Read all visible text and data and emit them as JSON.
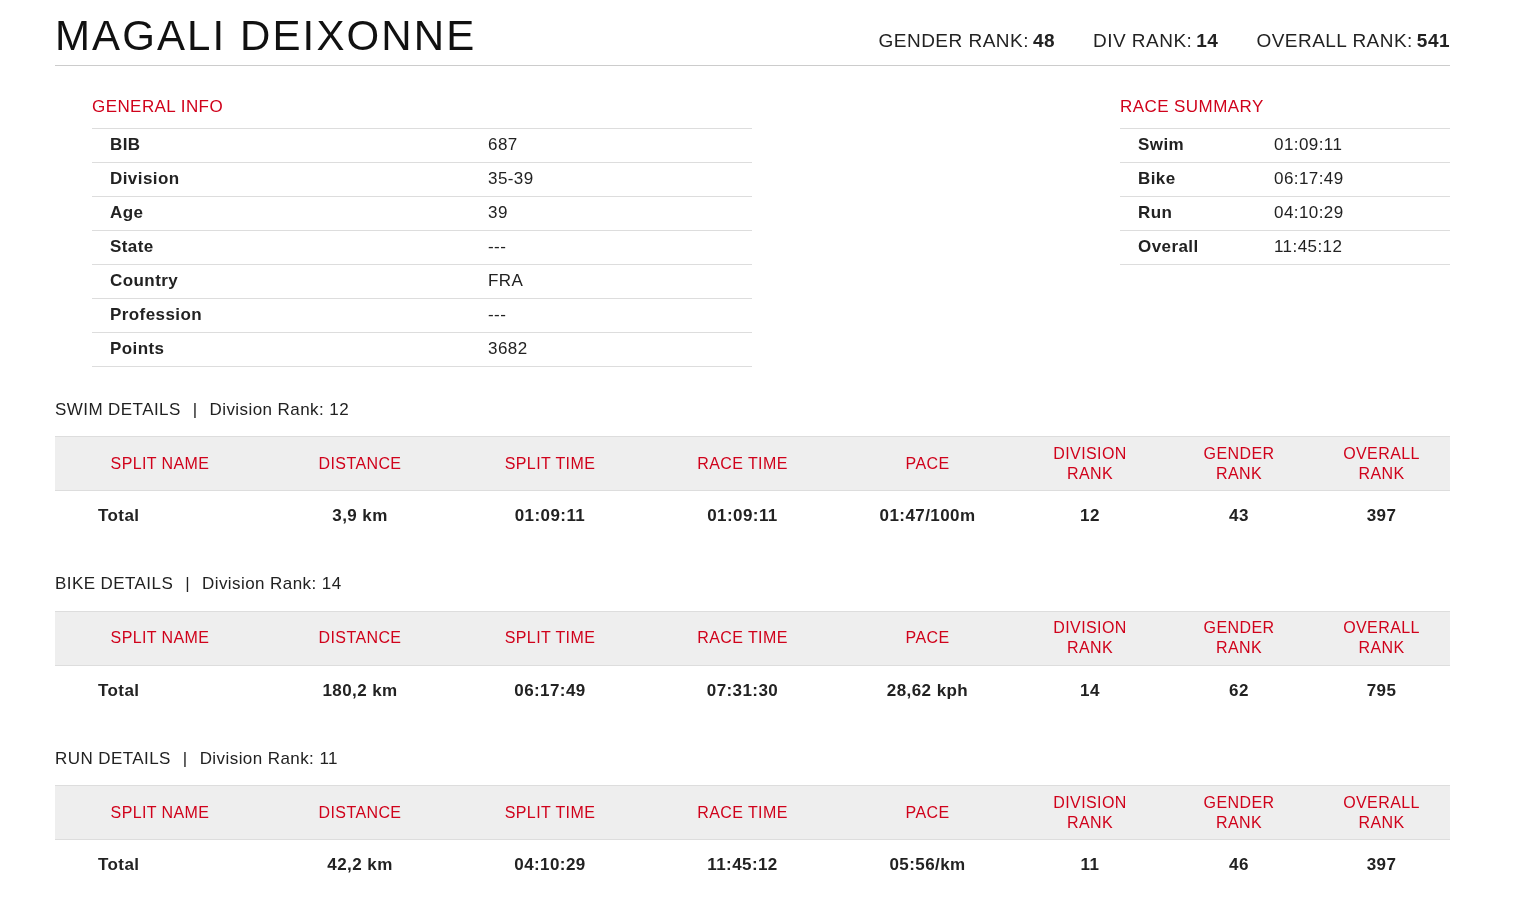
{
  "header": {
    "name": "MAGALI DEIXONNE",
    "ranks": [
      {
        "label": "GENDER RANK:",
        "value": "48"
      },
      {
        "label": "DIV RANK:",
        "value": "14"
      },
      {
        "label": "OVERALL RANK:",
        "value": "541"
      }
    ]
  },
  "general_info": {
    "title": "GENERAL INFO",
    "rows": [
      {
        "label": "BIB",
        "value": "687"
      },
      {
        "label": "Division",
        "value": "35-39"
      },
      {
        "label": "Age",
        "value": "39"
      },
      {
        "label": "State",
        "value": "---"
      },
      {
        "label": "Country",
        "value": "FRA"
      },
      {
        "label": "Profession",
        "value": "---"
      },
      {
        "label": "Points",
        "value": "3682"
      }
    ]
  },
  "race_summary": {
    "title": "RACE SUMMARY",
    "rows": [
      {
        "label": "Swim",
        "value": "01:09:11"
      },
      {
        "label": "Bike",
        "value": "06:17:49"
      },
      {
        "label": "Run",
        "value": "04:10:29"
      },
      {
        "label": "Overall",
        "value": "11:45:12"
      }
    ]
  },
  "details": [
    {
      "title": "SWIM DETAILS",
      "separator": "|",
      "division_rank": "Division Rank: 12",
      "columns": [
        "SPLIT NAME",
        "DISTANCE",
        "SPLIT TIME",
        "RACE TIME",
        "PACE",
        "DIVISION RANK",
        "GENDER RANK",
        "OVERALL RANK"
      ],
      "rows": [
        [
          "Total",
          "3,9 km",
          "01:09:11",
          "01:09:11",
          "01:47/100m",
          "12",
          "43",
          "397"
        ]
      ]
    },
    {
      "title": "BIKE DETAILS",
      "separator": "|",
      "division_rank": "Division Rank: 14",
      "columns": [
        "SPLIT NAME",
        "DISTANCE",
        "SPLIT TIME",
        "RACE TIME",
        "PACE",
        "DIVISION RANK",
        "GENDER RANK",
        "OVERALL RANK"
      ],
      "rows": [
        [
          "Total",
          "180,2 km",
          "06:17:49",
          "07:31:30",
          "28,62 kph",
          "14",
          "62",
          "795"
        ]
      ]
    },
    {
      "title": "RUN DETAILS",
      "separator": "|",
      "division_rank": "Division Rank: 11",
      "columns": [
        "SPLIT NAME",
        "DISTANCE",
        "SPLIT TIME",
        "RACE TIME",
        "PACE",
        "DIVISION RANK",
        "GENDER RANK",
        "OVERALL RANK"
      ],
      "rows": [
        [
          "Total",
          "42,2 km",
          "04:10:29",
          "11:45:12",
          "05:56/km",
          "11",
          "46",
          "397"
        ]
      ]
    }
  ]
}
